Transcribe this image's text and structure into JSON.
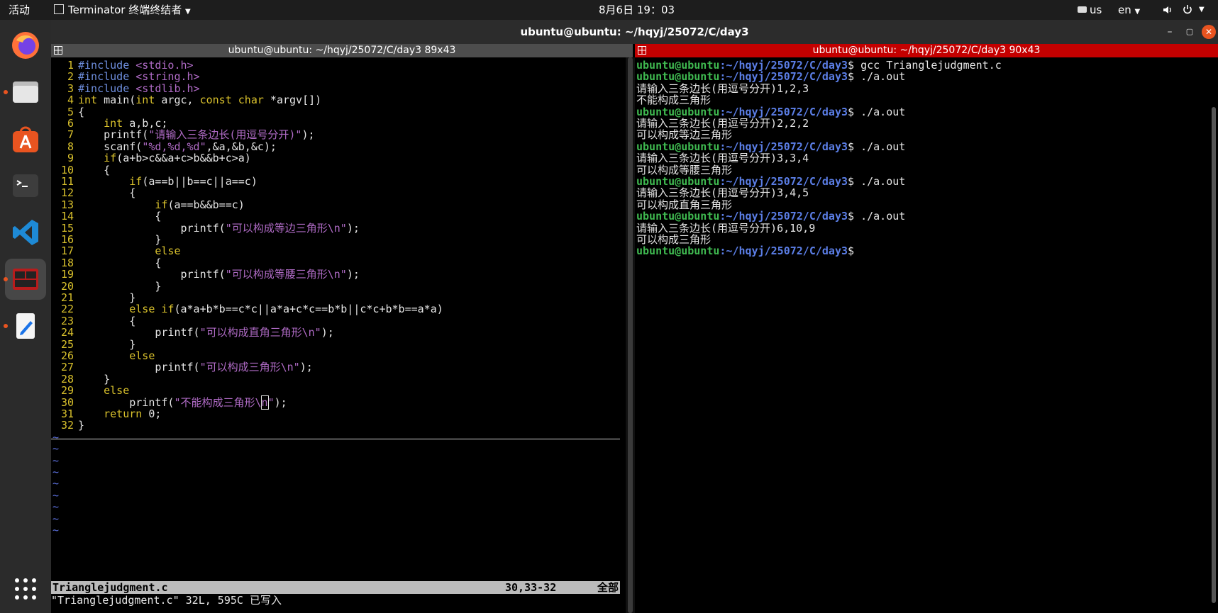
{
  "topbar": {
    "activities": "活动",
    "app_name": "Terminator 终端终结者",
    "clock": "8月6日  19：03",
    "keyboard": "us",
    "lang": "en"
  },
  "window": {
    "title": "ubuntu@ubuntu: ~/hqyj/25072/C/day3",
    "minimize": "–",
    "maximize": "▢",
    "close": "✕"
  },
  "left_pane": {
    "title": "ubuntu@ubuntu: ~/hqyj/25072/C/day3 89x43",
    "lines": [
      {
        "n": "1",
        "segs": [
          {
            "t": "#include ",
            "c": "pre"
          },
          {
            "t": "<stdio.h>",
            "c": "str"
          }
        ]
      },
      {
        "n": "2",
        "segs": [
          {
            "t": "#include ",
            "c": "pre"
          },
          {
            "t": "<string.h>",
            "c": "str"
          }
        ]
      },
      {
        "n": "3",
        "segs": [
          {
            "t": "#include ",
            "c": "pre"
          },
          {
            "t": "<stdlib.h>",
            "c": "str"
          }
        ]
      },
      {
        "n": "4",
        "segs": [
          {
            "t": "int",
            "c": "kw"
          },
          {
            "t": " main(",
            "c": "code"
          },
          {
            "t": "int",
            "c": "kw"
          },
          {
            "t": " argc, ",
            "c": "code"
          },
          {
            "t": "const",
            "c": "kw"
          },
          {
            "t": " ",
            "c": "code"
          },
          {
            "t": "char",
            "c": "kw"
          },
          {
            "t": " *argv[])",
            "c": "code"
          }
        ]
      },
      {
        "n": "5",
        "segs": [
          {
            "t": "{",
            "c": "code"
          }
        ]
      },
      {
        "n": "6",
        "segs": [
          {
            "t": "    ",
            "c": "code"
          },
          {
            "t": "int",
            "c": "kw"
          },
          {
            "t": " a,b,c;",
            "c": "code"
          }
        ]
      },
      {
        "n": "7",
        "segs": [
          {
            "t": "    printf(",
            "c": "code"
          },
          {
            "t": "\"请输入三条边长(用逗号分开)\"",
            "c": "str"
          },
          {
            "t": ");",
            "c": "code"
          }
        ]
      },
      {
        "n": "8",
        "segs": [
          {
            "t": "    scanf(",
            "c": "code"
          },
          {
            "t": "\"%d,%d,%d\"",
            "c": "str"
          },
          {
            "t": ",&a,&b,&c);",
            "c": "code"
          }
        ]
      },
      {
        "n": "9",
        "segs": [
          {
            "t": "    ",
            "c": "code"
          },
          {
            "t": "if",
            "c": "kw"
          },
          {
            "t": "(a+b>c&&a+c>b&&b+c>a)",
            "c": "code"
          }
        ]
      },
      {
        "n": "10",
        "segs": [
          {
            "t": "    {",
            "c": "code"
          }
        ]
      },
      {
        "n": "11",
        "segs": [
          {
            "t": "        ",
            "c": "code"
          },
          {
            "t": "if",
            "c": "kw"
          },
          {
            "t": "(a==b||b==c||a==c)",
            "c": "code"
          }
        ]
      },
      {
        "n": "12",
        "segs": [
          {
            "t": "        {",
            "c": "code"
          }
        ]
      },
      {
        "n": "13",
        "segs": [
          {
            "t": "            ",
            "c": "code"
          },
          {
            "t": "if",
            "c": "kw"
          },
          {
            "t": "(a==b&&b==c)",
            "c": "code"
          }
        ]
      },
      {
        "n": "14",
        "segs": [
          {
            "t": "            {",
            "c": "code"
          }
        ]
      },
      {
        "n": "15",
        "segs": [
          {
            "t": "                printf(",
            "c": "code"
          },
          {
            "t": "\"可以构成等边三角形\\n\"",
            "c": "str"
          },
          {
            "t": ");",
            "c": "code"
          }
        ]
      },
      {
        "n": "16",
        "segs": [
          {
            "t": "            }",
            "c": "code"
          }
        ]
      },
      {
        "n": "17",
        "segs": [
          {
            "t": "            ",
            "c": "code"
          },
          {
            "t": "else",
            "c": "kw"
          }
        ]
      },
      {
        "n": "18",
        "segs": [
          {
            "t": "            {",
            "c": "code"
          }
        ]
      },
      {
        "n": "19",
        "segs": [
          {
            "t": "                printf(",
            "c": "code"
          },
          {
            "t": "\"可以构成等腰三角形\\n\"",
            "c": "str"
          },
          {
            "t": ");",
            "c": "code"
          }
        ]
      },
      {
        "n": "20",
        "segs": [
          {
            "t": "            }",
            "c": "code"
          }
        ]
      },
      {
        "n": "21",
        "segs": [
          {
            "t": "        }",
            "c": "code"
          }
        ]
      },
      {
        "n": "22",
        "segs": [
          {
            "t": "        ",
            "c": "code"
          },
          {
            "t": "else if",
            "c": "kw"
          },
          {
            "t": "(a*a+b*b==c*c||a*a+c*c==b*b||c*c+b*b==a*a)",
            "c": "code"
          }
        ]
      },
      {
        "n": "23",
        "segs": [
          {
            "t": "        {",
            "c": "code"
          }
        ]
      },
      {
        "n": "24",
        "segs": [
          {
            "t": "            printf(",
            "c": "code"
          },
          {
            "t": "\"可以构成直角三角形\\n\"",
            "c": "str"
          },
          {
            "t": ");",
            "c": "code"
          }
        ]
      },
      {
        "n": "25",
        "segs": [
          {
            "t": "        }",
            "c": "code"
          }
        ]
      },
      {
        "n": "26",
        "segs": [
          {
            "t": "        ",
            "c": "code"
          },
          {
            "t": "else",
            "c": "kw"
          }
        ]
      },
      {
        "n": "27",
        "segs": [
          {
            "t": "            printf(",
            "c": "code"
          },
          {
            "t": "\"可以构成三角形\\n\"",
            "c": "str"
          },
          {
            "t": ");",
            "c": "code"
          }
        ]
      },
      {
        "n": "28",
        "segs": [
          {
            "t": "    }",
            "c": "code"
          }
        ]
      },
      {
        "n": "29",
        "segs": [
          {
            "t": "    ",
            "c": "code"
          },
          {
            "t": "else",
            "c": "kw"
          }
        ]
      },
      {
        "n": "30",
        "segs": [
          {
            "t": "        printf(",
            "c": "code"
          },
          {
            "t": "\"不能构成三角形\\",
            "c": "str"
          },
          {
            "t": "n",
            "c": "str cursor"
          },
          {
            "t": "\"",
            "c": "str"
          },
          {
            "t": ");",
            "c": "code"
          }
        ]
      },
      {
        "n": "31",
        "segs": [
          {
            "t": "    ",
            "c": "code"
          },
          {
            "t": "return",
            "c": "kw"
          },
          {
            "t": " 0;",
            "c": "code"
          }
        ]
      },
      {
        "n": "32",
        "segs": [
          {
            "t": "}",
            "c": "code"
          }
        ]
      }
    ],
    "tilde": "~",
    "status_file": "Trianglejudgment.c",
    "status_pos": "30,33-32",
    "status_all": "全部",
    "message": "\"Trianglejudgment.c\" 32L, 595C 已写入"
  },
  "right_pane": {
    "title": "ubuntu@ubuntu: ~/hqyj/25072/C/day3 90x43",
    "prompt_user": "ubuntu@ubuntu",
    "prompt_path": ":~/hqyj/25072/C/day3",
    "lines": [
      {
        "type": "prompt",
        "cmd": "$ gcc Trianglejudgment.c"
      },
      {
        "type": "prompt",
        "cmd": "$ ./a.out"
      },
      {
        "type": "out",
        "text": "请输入三条边长(用逗号分开)1,2,3"
      },
      {
        "type": "out",
        "text": "不能构成三角形"
      },
      {
        "type": "prompt",
        "cmd": "$ ./a.out"
      },
      {
        "type": "out",
        "text": "请输入三条边长(用逗号分开)2,2,2"
      },
      {
        "type": "out",
        "text": "可以构成等边三角形"
      },
      {
        "type": "prompt",
        "cmd": "$ ./a.out"
      },
      {
        "type": "out",
        "text": "请输入三条边长(用逗号分开)3,3,4"
      },
      {
        "type": "out",
        "text": "可以构成等腰三角形"
      },
      {
        "type": "prompt",
        "cmd": "$ ./a.out"
      },
      {
        "type": "out",
        "text": "请输入三条边长(用逗号分开)3,4,5"
      },
      {
        "type": "out",
        "text": "可以构成直角三角形"
      },
      {
        "type": "prompt",
        "cmd": "$ ./a.out"
      },
      {
        "type": "out",
        "text": "请输入三条边长(用逗号分开)6,10,9"
      },
      {
        "type": "out",
        "text": "可以构成三角形"
      },
      {
        "type": "prompt",
        "cmd": "$"
      }
    ]
  },
  "dock": {
    "items": [
      {
        "name": "firefox-icon",
        "running": false,
        "active": false
      },
      {
        "name": "files-icon",
        "running": true,
        "active": false
      },
      {
        "name": "app-center-icon",
        "running": false,
        "active": false
      },
      {
        "name": "terminal-icon",
        "running": false,
        "active": false
      },
      {
        "name": "vscode-icon",
        "running": false,
        "active": false
      },
      {
        "name": "terminator-icon",
        "running": true,
        "active": true
      },
      {
        "name": "text-editor-icon",
        "running": true,
        "active": false
      }
    ],
    "grid": "show-apps-icon"
  },
  "colors": {
    "accent": "#e95420",
    "prompt_user": "#3fb950",
    "prompt_path": "#5b7ee6",
    "active_pane_title": "#c40000"
  }
}
